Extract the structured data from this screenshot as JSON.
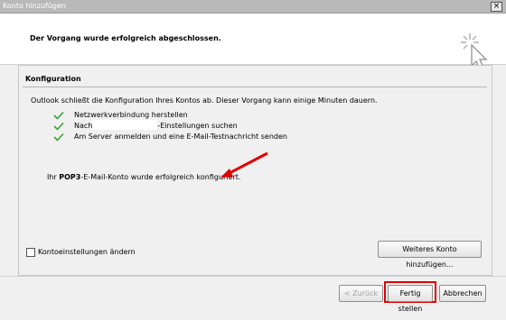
{
  "window": {
    "title": "Konto hinzufügen",
    "close_label": "×"
  },
  "header": {
    "message": "Der Vorgang wurde erfolgreich abgeschlossen."
  },
  "config": {
    "section_title": "Konfiguration",
    "description": "Outlook schließt die Konfiguration Ihres Kontos ab. Dieser Vorgang kann einige Minuten dauern.",
    "steps": [
      {
        "text": "Netzwerkverbindung herstellen"
      },
      {
        "text_before": "Nach",
        "text_after": "-Einstellungen suchen"
      },
      {
        "text": "Am Server anmelden und eine E-Mail-Testnachricht senden"
      }
    ],
    "result_prefix": "Ihr ",
    "result_bold": "POP3",
    "result_suffix": "-E-Mail-Konto wurde erfolgreich konfiguriert.",
    "change_settings_label": "Kontoeinstellungen ändern",
    "add_another_label": "Weiteres Konto hinzufügen..."
  },
  "footer": {
    "back_label": "< Zurück",
    "finish_label": "Fertig stellen",
    "cancel_label": "Abbrechen"
  },
  "colors": {
    "check": "#3aa23a",
    "annotation": "#e00000"
  }
}
